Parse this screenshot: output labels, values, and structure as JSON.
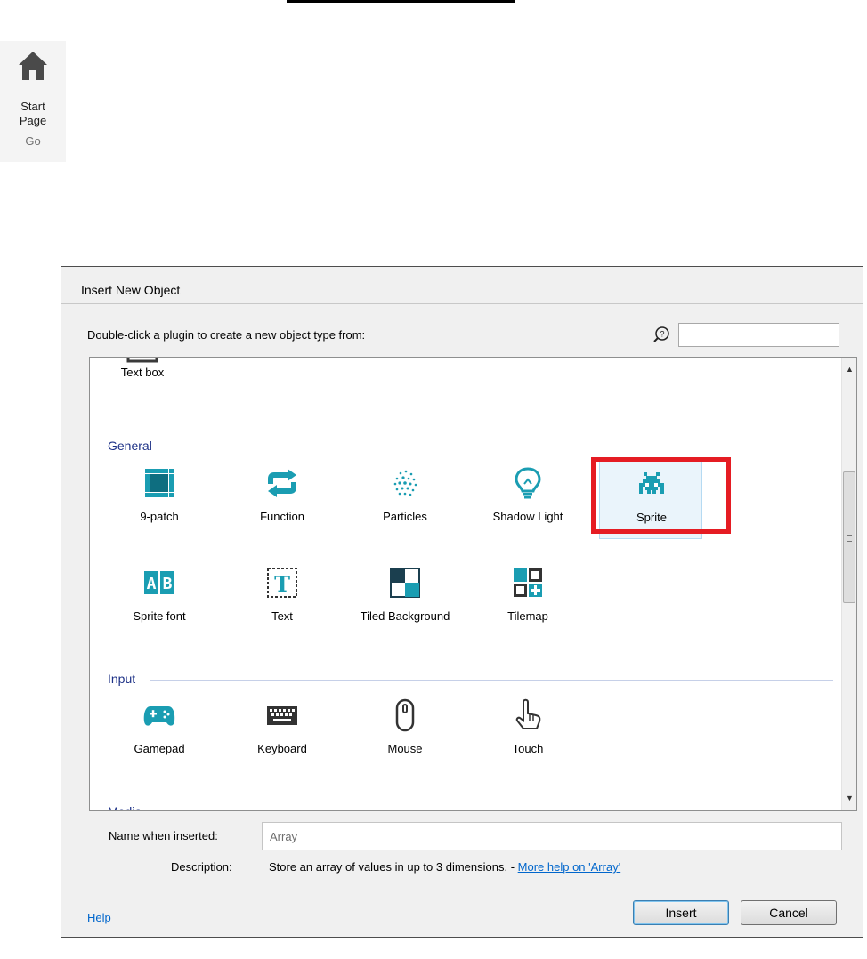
{
  "start_page": {
    "line1": "Start",
    "line2": "Page",
    "group": "Go",
    "icon": "home-icon"
  },
  "dialog": {
    "title": "Insert New Object",
    "instructions": "Double-click a plugin to create a new object type from:",
    "search": {
      "value": "",
      "placeholder": ""
    },
    "partial_item": {
      "label": "Text box"
    },
    "groups": [
      {
        "label": "General",
        "items": [
          {
            "label": "9-patch",
            "icon": "ninepatch-icon"
          },
          {
            "label": "Function",
            "icon": "function-icon"
          },
          {
            "label": "Particles",
            "icon": "particles-icon"
          },
          {
            "label": "Shadow Light",
            "icon": "lightbulb-icon"
          },
          {
            "label": "Sprite",
            "icon": "space-invader-icon",
            "selected": true
          },
          {
            "label": "Sprite font",
            "icon": "sprite-font-icon"
          },
          {
            "label": "Text",
            "icon": "text-icon"
          },
          {
            "label": "Tiled Background",
            "icon": "tiled-background-icon"
          },
          {
            "label": "Tilemap",
            "icon": "tilemap-icon"
          }
        ]
      },
      {
        "label": "Input",
        "items": [
          {
            "label": "Gamepad",
            "icon": "gamepad-icon"
          },
          {
            "label": "Keyboard",
            "icon": "keyboard-icon"
          },
          {
            "label": "Mouse",
            "icon": "mouse-icon"
          },
          {
            "label": "Touch",
            "icon": "touch-icon"
          }
        ]
      },
      {
        "label": "Media",
        "items": []
      }
    ],
    "name_label": "Name when inserted:",
    "name_value": "Array",
    "description_label": "Description:",
    "description_text": "Store an array of values in up to 3 dimensions. - ",
    "description_link": "More help on 'Array'",
    "help_link": "Help",
    "insert_button": "Insert",
    "cancel_button": "Cancel"
  },
  "colors": {
    "icon_teal": "#1a9db2",
    "highlight_red": "#e51c23",
    "group_blue": "#1e3287"
  }
}
